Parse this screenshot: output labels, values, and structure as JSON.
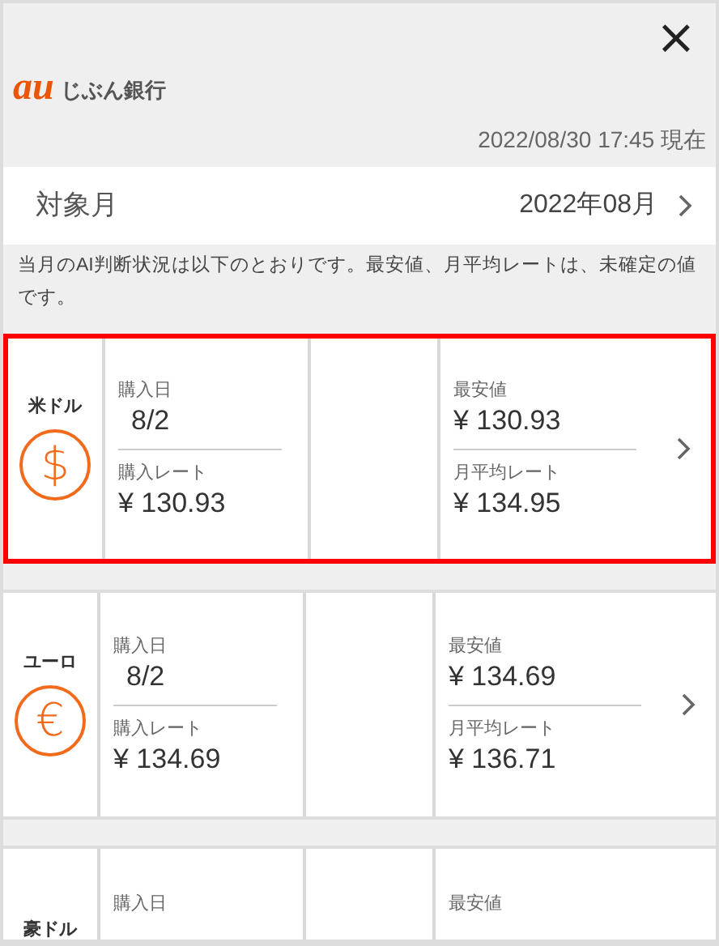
{
  "close_label": "×",
  "logo": {
    "mark": "au",
    "name": "じぶん銀行"
  },
  "timestamp": "2022/08/30 17:45 現在",
  "month_row": {
    "label": "対象月",
    "value": "2022年08月"
  },
  "note": "当月のAI判断状況は以下のとおりです。最安値、月平均レートは、未確定の値です。",
  "cards": [
    {
      "currency": "米ドル",
      "symbol": "$",
      "highlighted": true,
      "purchase_date_label": "購入日",
      "purchase_date": "8/2",
      "purchase_rate_label": "購入レート",
      "purchase_rate": "¥ 130.93",
      "min_label": "最安値",
      "min_value": "¥ 130.93",
      "avg_label": "月平均レート",
      "avg_value": "¥ 134.95"
    },
    {
      "currency": "ユーロ",
      "symbol": "€",
      "highlighted": false,
      "purchase_date_label": "購入日",
      "purchase_date": "8/2",
      "purchase_rate_label": "購入レート",
      "purchase_rate": "¥ 134.69",
      "min_label": "最安値",
      "min_value": "¥ 134.69",
      "avg_label": "月平均レート",
      "avg_value": "¥ 136.71"
    },
    {
      "currency": "豪ドル",
      "highlighted": false,
      "purchase_date_label": "購入日",
      "min_label": "最安値"
    }
  ]
}
